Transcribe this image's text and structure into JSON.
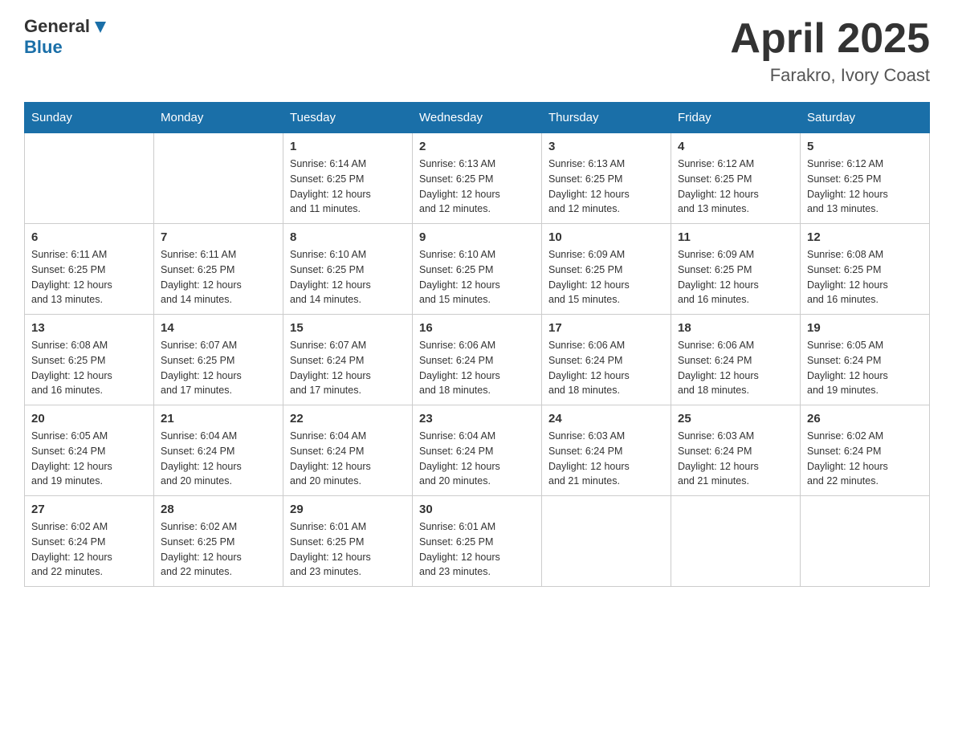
{
  "header": {
    "logo_general": "General",
    "logo_blue": "Blue",
    "title": "April 2025",
    "subtitle": "Farakro, Ivory Coast"
  },
  "days_of_week": [
    "Sunday",
    "Monday",
    "Tuesday",
    "Wednesday",
    "Thursday",
    "Friday",
    "Saturday"
  ],
  "weeks": [
    [
      {
        "day": "",
        "info": ""
      },
      {
        "day": "",
        "info": ""
      },
      {
        "day": "1",
        "info": "Sunrise: 6:14 AM\nSunset: 6:25 PM\nDaylight: 12 hours\nand 11 minutes."
      },
      {
        "day": "2",
        "info": "Sunrise: 6:13 AM\nSunset: 6:25 PM\nDaylight: 12 hours\nand 12 minutes."
      },
      {
        "day": "3",
        "info": "Sunrise: 6:13 AM\nSunset: 6:25 PM\nDaylight: 12 hours\nand 12 minutes."
      },
      {
        "day": "4",
        "info": "Sunrise: 6:12 AM\nSunset: 6:25 PM\nDaylight: 12 hours\nand 13 minutes."
      },
      {
        "day": "5",
        "info": "Sunrise: 6:12 AM\nSunset: 6:25 PM\nDaylight: 12 hours\nand 13 minutes."
      }
    ],
    [
      {
        "day": "6",
        "info": "Sunrise: 6:11 AM\nSunset: 6:25 PM\nDaylight: 12 hours\nand 13 minutes."
      },
      {
        "day": "7",
        "info": "Sunrise: 6:11 AM\nSunset: 6:25 PM\nDaylight: 12 hours\nand 14 minutes."
      },
      {
        "day": "8",
        "info": "Sunrise: 6:10 AM\nSunset: 6:25 PM\nDaylight: 12 hours\nand 14 minutes."
      },
      {
        "day": "9",
        "info": "Sunrise: 6:10 AM\nSunset: 6:25 PM\nDaylight: 12 hours\nand 15 minutes."
      },
      {
        "day": "10",
        "info": "Sunrise: 6:09 AM\nSunset: 6:25 PM\nDaylight: 12 hours\nand 15 minutes."
      },
      {
        "day": "11",
        "info": "Sunrise: 6:09 AM\nSunset: 6:25 PM\nDaylight: 12 hours\nand 16 minutes."
      },
      {
        "day": "12",
        "info": "Sunrise: 6:08 AM\nSunset: 6:25 PM\nDaylight: 12 hours\nand 16 minutes."
      }
    ],
    [
      {
        "day": "13",
        "info": "Sunrise: 6:08 AM\nSunset: 6:25 PM\nDaylight: 12 hours\nand 16 minutes."
      },
      {
        "day": "14",
        "info": "Sunrise: 6:07 AM\nSunset: 6:25 PM\nDaylight: 12 hours\nand 17 minutes."
      },
      {
        "day": "15",
        "info": "Sunrise: 6:07 AM\nSunset: 6:24 PM\nDaylight: 12 hours\nand 17 minutes."
      },
      {
        "day": "16",
        "info": "Sunrise: 6:06 AM\nSunset: 6:24 PM\nDaylight: 12 hours\nand 18 minutes."
      },
      {
        "day": "17",
        "info": "Sunrise: 6:06 AM\nSunset: 6:24 PM\nDaylight: 12 hours\nand 18 minutes."
      },
      {
        "day": "18",
        "info": "Sunrise: 6:06 AM\nSunset: 6:24 PM\nDaylight: 12 hours\nand 18 minutes."
      },
      {
        "day": "19",
        "info": "Sunrise: 6:05 AM\nSunset: 6:24 PM\nDaylight: 12 hours\nand 19 minutes."
      }
    ],
    [
      {
        "day": "20",
        "info": "Sunrise: 6:05 AM\nSunset: 6:24 PM\nDaylight: 12 hours\nand 19 minutes."
      },
      {
        "day": "21",
        "info": "Sunrise: 6:04 AM\nSunset: 6:24 PM\nDaylight: 12 hours\nand 20 minutes."
      },
      {
        "day": "22",
        "info": "Sunrise: 6:04 AM\nSunset: 6:24 PM\nDaylight: 12 hours\nand 20 minutes."
      },
      {
        "day": "23",
        "info": "Sunrise: 6:04 AM\nSunset: 6:24 PM\nDaylight: 12 hours\nand 20 minutes."
      },
      {
        "day": "24",
        "info": "Sunrise: 6:03 AM\nSunset: 6:24 PM\nDaylight: 12 hours\nand 21 minutes."
      },
      {
        "day": "25",
        "info": "Sunrise: 6:03 AM\nSunset: 6:24 PM\nDaylight: 12 hours\nand 21 minutes."
      },
      {
        "day": "26",
        "info": "Sunrise: 6:02 AM\nSunset: 6:24 PM\nDaylight: 12 hours\nand 22 minutes."
      }
    ],
    [
      {
        "day": "27",
        "info": "Sunrise: 6:02 AM\nSunset: 6:24 PM\nDaylight: 12 hours\nand 22 minutes."
      },
      {
        "day": "28",
        "info": "Sunrise: 6:02 AM\nSunset: 6:25 PM\nDaylight: 12 hours\nand 22 minutes."
      },
      {
        "day": "29",
        "info": "Sunrise: 6:01 AM\nSunset: 6:25 PM\nDaylight: 12 hours\nand 23 minutes."
      },
      {
        "day": "30",
        "info": "Sunrise: 6:01 AM\nSunset: 6:25 PM\nDaylight: 12 hours\nand 23 minutes."
      },
      {
        "day": "",
        "info": ""
      },
      {
        "day": "",
        "info": ""
      },
      {
        "day": "",
        "info": ""
      }
    ]
  ]
}
